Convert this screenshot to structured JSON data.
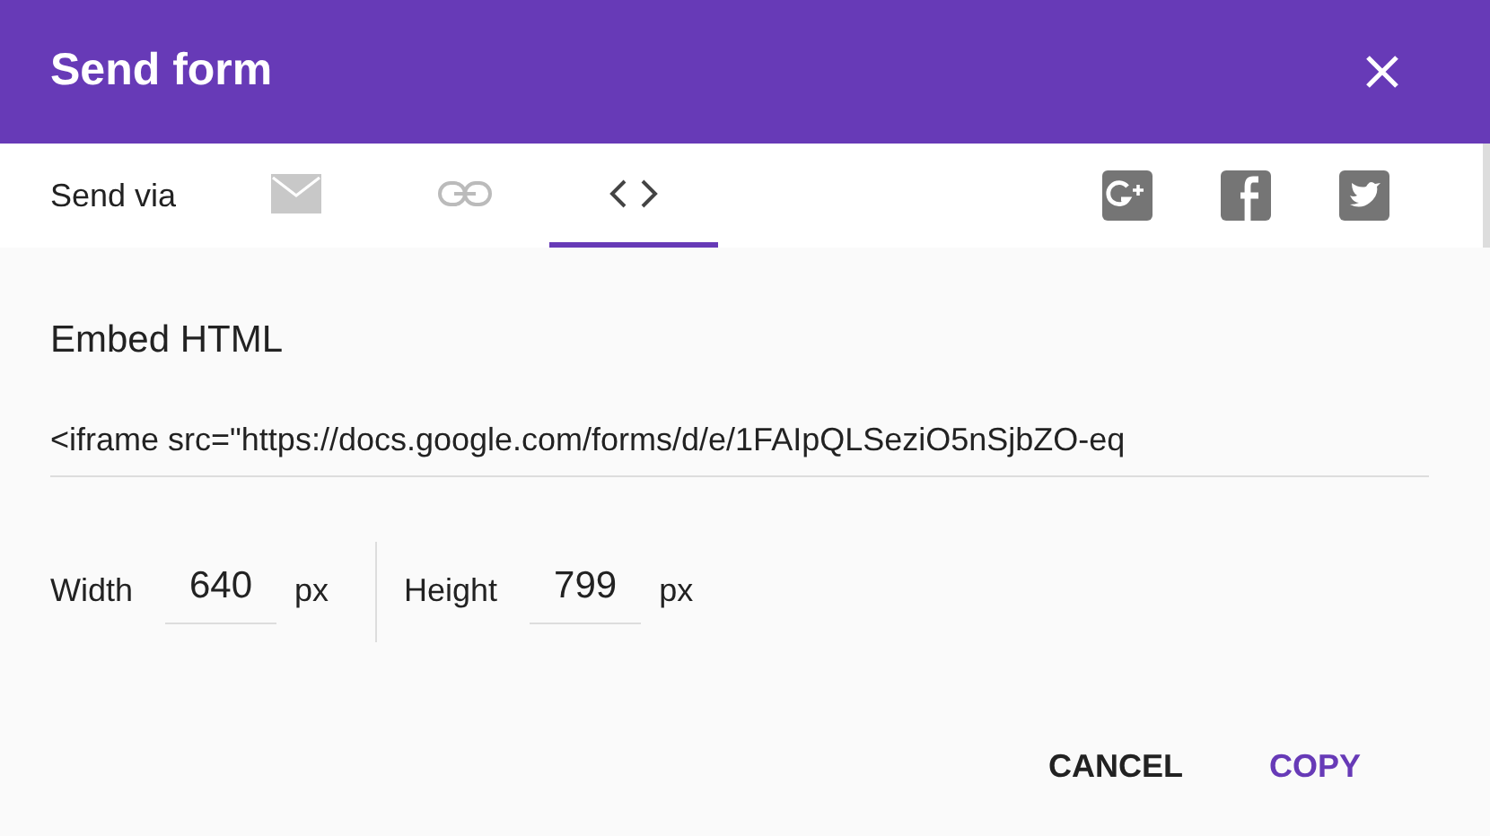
{
  "dialog": {
    "title": "Send form"
  },
  "send_via": {
    "label": "Send via",
    "tabs": [
      {
        "kind": "email",
        "selected": false
      },
      {
        "kind": "link",
        "selected": false
      },
      {
        "kind": "embed",
        "selected": true
      }
    ],
    "share": [
      {
        "kind": "googleplus"
      },
      {
        "kind": "facebook"
      },
      {
        "kind": "twitter"
      }
    ]
  },
  "embed": {
    "heading": "Embed HTML",
    "code": "<iframe src=\"https://docs.google.com/forms/d/e/1FAIpQLSeziO5nSjbZO-eq",
    "width": {
      "label": "Width",
      "value": "640",
      "unit": "px"
    },
    "height": {
      "label": "Height",
      "value": "799",
      "unit": "px"
    }
  },
  "buttons": [
    {
      "label": "CANCEL",
      "kind": "secondary"
    },
    {
      "label": "COPY",
      "kind": "primary"
    }
  ]
}
